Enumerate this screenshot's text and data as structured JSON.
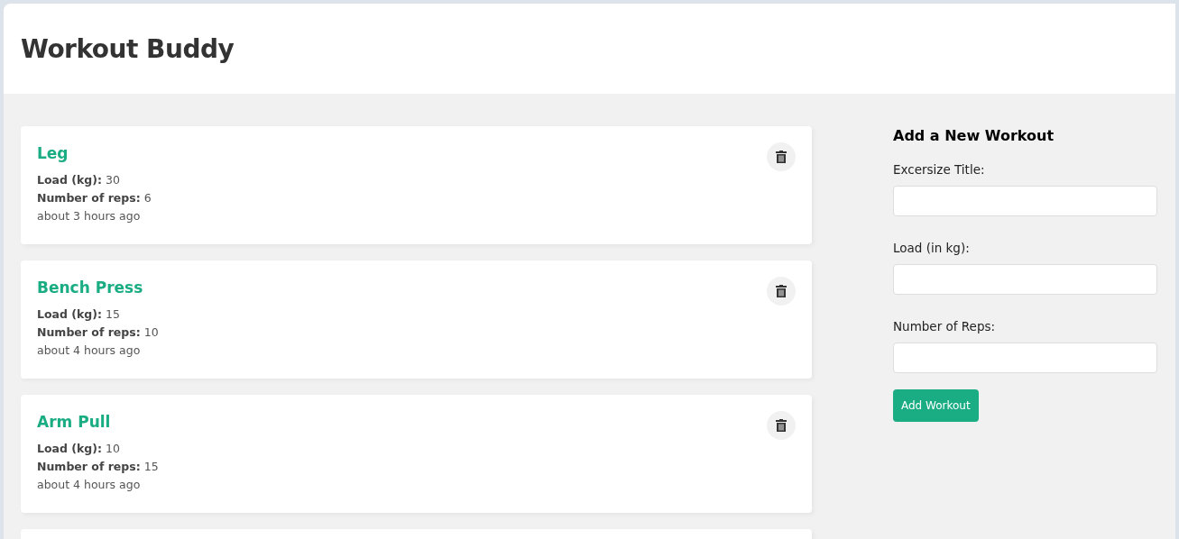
{
  "header": {
    "title": "Workout Buddy"
  },
  "workouts": [
    {
      "title": "Leg",
      "details": [
        "**Load (kg):** 30",
        "**Number of reps:** 6"
      ],
      "time": "about 3 hours ago"
    },
    {
      "title": "Bench Press",
      "details": [
        "**Load (kg):** 15",
        "**Number of reps:** 10"
      ],
      "time": "about 4 hours ago"
    },
    {
      "title": "Arm Pull",
      "details": [
        "**Load (kg):** 10",
        "**Number of reps:** 15"
      ],
      "time": "about 4 hours ago"
    },
    {
      "kind": "empty"
    }
  ],
  "form": {
    "heading": "Add a New Workout",
    "fields": [
      {
        "label": "Excersize Title:"
      },
      {
        "label": "Load (in kg):"
      },
      {
        "label": "Number of Reps:"
      }
    ],
    "button": "Add Workout"
  }
}
